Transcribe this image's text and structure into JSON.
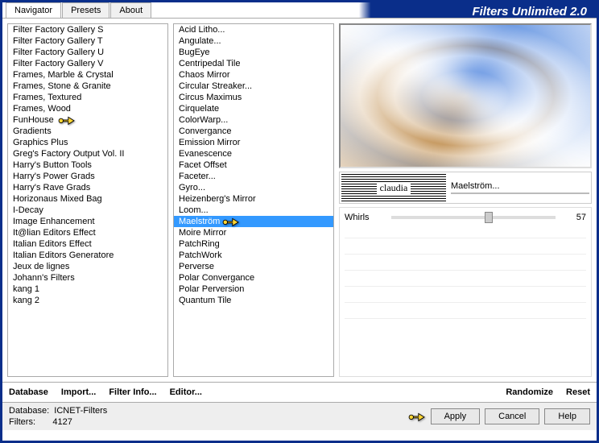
{
  "title": "Filters Unlimited 2.0",
  "tabs": [
    {
      "label": "Navigator",
      "active": true
    },
    {
      "label": "Presets",
      "active": false
    },
    {
      "label": "About",
      "active": false
    }
  ],
  "categories": [
    "Filter Factory Gallery S",
    "Filter Factory Gallery T",
    "Filter Factory Gallery U",
    "Filter Factory Gallery V",
    "Frames, Marble & Crystal",
    "Frames, Stone & Granite",
    "Frames, Textured",
    "Frames, Wood",
    "FunHouse",
    "Gradients",
    "Graphics Plus",
    "Greg's Factory Output Vol. II",
    "Harry's Button Tools",
    "Harry's Power Grads",
    "Harry's Rave Grads",
    "Horizonaus Mixed Bag",
    "I-Decay",
    "Image Enhancement",
    "It@lian Editors Effect",
    "Italian Editors Effect",
    "Italian Editors Generatore",
    "Jeux de lignes",
    "Johann's Filters",
    "kang 1",
    "kang 2"
  ],
  "category_pointer_index": 8,
  "filters": [
    "Acid Litho...",
    "Angulate...",
    "BugEye",
    "Centripedal Tile",
    "Chaos Mirror",
    "Circular Streaker...",
    "Circus Maximus",
    "Cirquelate",
    "ColorWarp...",
    "Convergance",
    "Emission Mirror",
    "Evanescence",
    "Facet Offset",
    "Faceter...",
    "Gyro...",
    "Heizenberg's Mirror",
    "Loom...",
    "Maelström",
    "Moire Mirror",
    "PatchRing",
    "PatchWork",
    "Perverse",
    "Polar Convergance",
    "Polar Perversion",
    "Quantum Tile"
  ],
  "filter_selected_index": 17,
  "filter_pointer_index": 17,
  "current_filter": "Maelström...",
  "logo_text": "claudia",
  "slider": {
    "label": "Whirls",
    "value": 57,
    "pct": 57
  },
  "bottom": {
    "database": "Database",
    "import": "Import...",
    "filterinfo": "Filter Info...",
    "editor": "Editor...",
    "randomize": "Randomize",
    "reset": "Reset"
  },
  "status": {
    "db_label": "Database:",
    "db_value": "ICNET-Filters",
    "filters_label": "Filters:",
    "filters_value": "4127"
  },
  "buttons": {
    "apply": "Apply",
    "cancel": "Cancel",
    "help": "Help"
  }
}
